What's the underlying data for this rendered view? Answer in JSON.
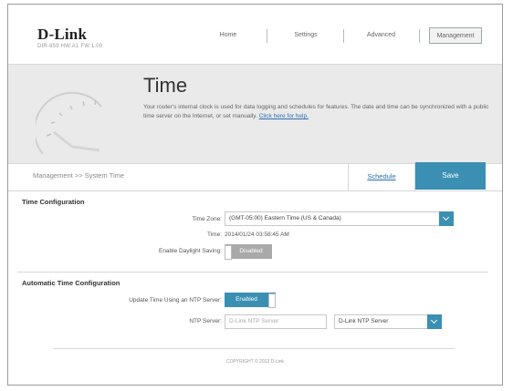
{
  "header": {
    "logo": "D-Link",
    "model_info": "DIR-859  HW:A1  FW:1.00",
    "nav": [
      {
        "label": "Home",
        "active": false
      },
      {
        "label": "Settings",
        "active": false
      },
      {
        "label": "Advanced",
        "active": false
      },
      {
        "label": "Management",
        "active": true
      }
    ]
  },
  "banner": {
    "title": "Time",
    "description": "Your router's internal clock is used for data logging and schedules for features. The date and time can be synchronized with a public time server on the Internet, or set manually.",
    "help_link": "Click here for help."
  },
  "breadcrumb": "Management >> System Time",
  "actions": {
    "schedule": "Schedule",
    "save": "Save"
  },
  "time_config": {
    "title": "Time Configuration",
    "time_zone_label": "Time Zone:",
    "time_zone_value": "(GMT-05:00) Eastern Time (US & Canada)",
    "time_label": "Time:",
    "time_value": "2014/01/24 03:58:45 AM",
    "daylight_label": "Enable Daylight Saving:",
    "daylight_value": "Disabled"
  },
  "auto_time_config": {
    "title": "Automatic Time Configuration",
    "ntp_toggle_label": "Update Time Using an NTP Server:",
    "ntp_toggle_value": "Enabled",
    "ntp_server_label": "NTP Server:",
    "ntp_server_placeholder": "D-Link NTP Server",
    "ntp_server_select": "D-Link NTP Server"
  },
  "footer": "COPYRIGHT © 2013 D-Link",
  "colors": {
    "accent": "#3a8fb3",
    "banner_bg": "#eaeaea",
    "toggle_off": "#a9a9a9"
  }
}
